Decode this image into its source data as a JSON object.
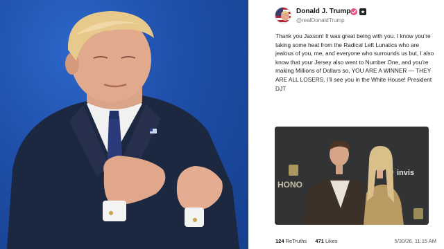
{
  "post": {
    "display_name": "Donald J. Trump",
    "handle": "@realDonaldTrump",
    "verified_icon": "verified-check-icon",
    "platform_badge_icon": "truth-social-icon",
    "text": "Thank you Jaxson! It was great being with you. I know you’re taking some heat from the Radical Left Lunatics who are jealous of you, me, and everyone who surrounds us but, I also know that your Jersey also went to Number One, and you’re making Millions of Dollars so, YOU ARE A WINNER — THEY ARE ALL LOSERS. I’ll see you in the White House! President DJT",
    "image_backdrop_text_1": "HONO",
    "image_backdrop_text_2": "invis",
    "retruths_count": "124",
    "retruths_label": "ReTruths",
    "likes_count": "471",
    "likes_label": "Likes",
    "timestamp": "5/30/26, 11:15 AM"
  },
  "colors": {
    "verified_badge": "#e8508a",
    "left_background": "#1e4ea8",
    "suit": "#1c2740"
  }
}
